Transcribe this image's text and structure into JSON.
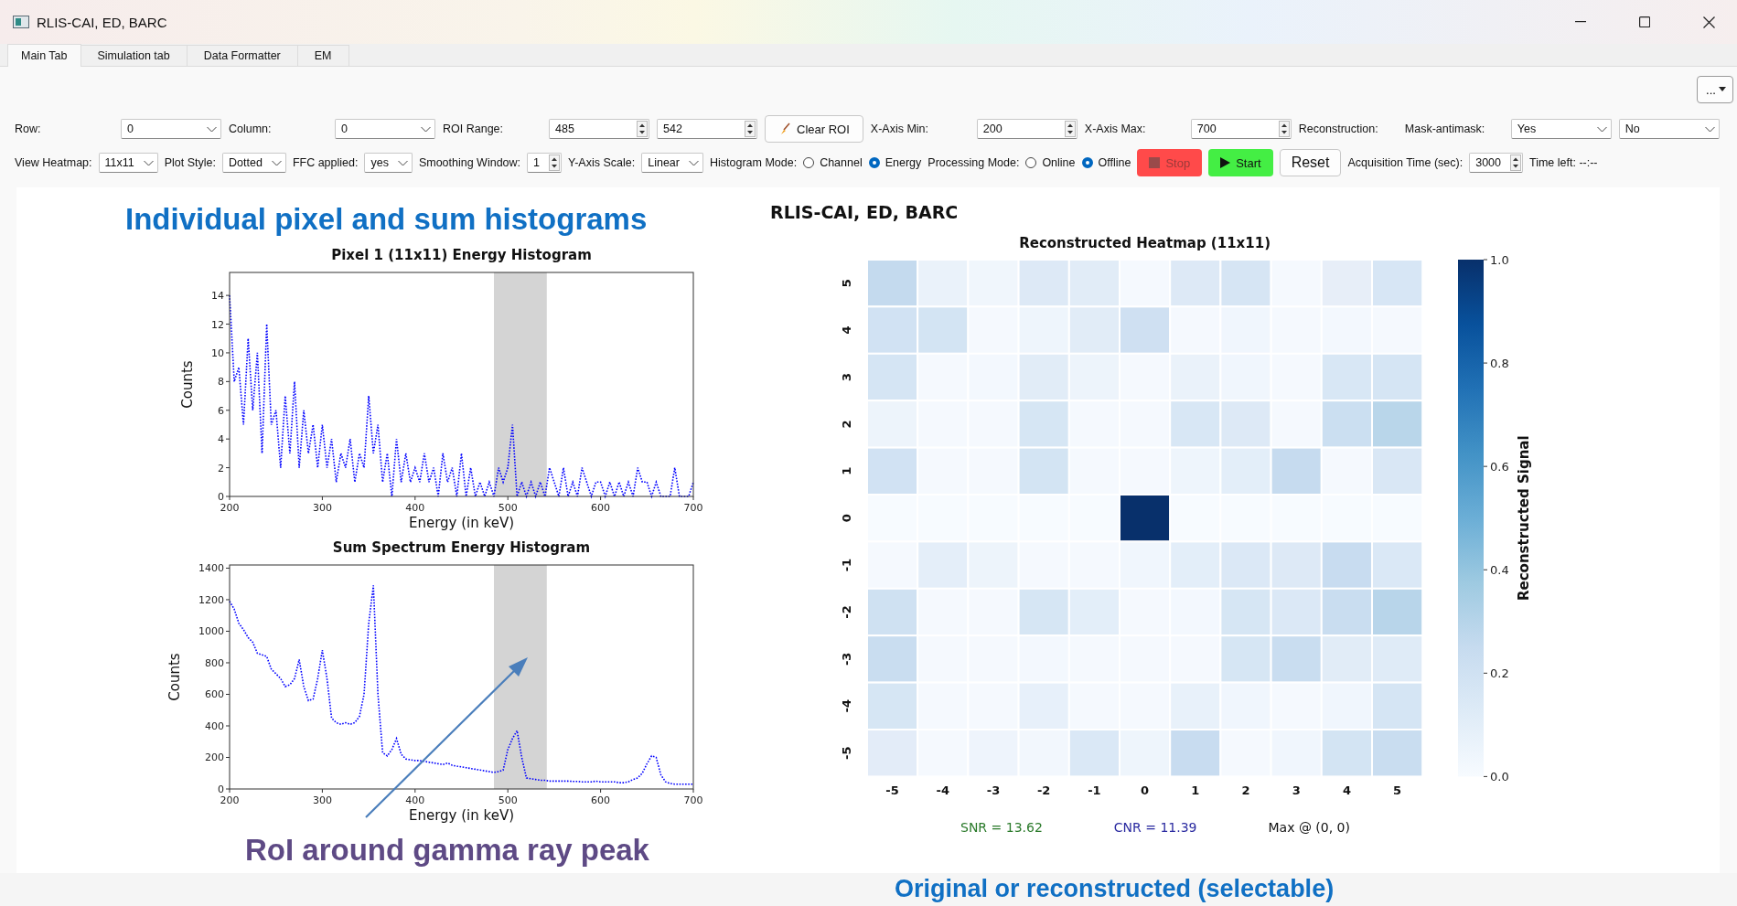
{
  "window": {
    "title": "RLIS-CAI, ED, BARC"
  },
  "tabs": [
    {
      "label": "Main Tab",
      "selected": true
    },
    {
      "label": "Simulation tab",
      "selected": false
    },
    {
      "label": "Data Formatter",
      "selected": false
    },
    {
      "label": "EM",
      "selected": false
    }
  ],
  "more_button": {
    "text": "..."
  },
  "toolbar_rows": [
    [
      {
        "kind": "label",
        "text": "Row:"
      },
      {
        "kind": "combo",
        "value": "0"
      },
      {
        "kind": "label",
        "text": "Column:"
      },
      {
        "kind": "combo",
        "value": "0"
      },
      {
        "kind": "label",
        "text": "ROI Range:"
      },
      {
        "kind": "spin",
        "value": "485"
      },
      {
        "kind": "spin",
        "value": "542"
      },
      {
        "kind": "brushbutton",
        "text": "Clear ROI",
        "disabled": false
      },
      {
        "kind": "label",
        "text": "X-Axis Min:"
      },
      {
        "kind": "spin",
        "value": "200"
      },
      {
        "kind": "label",
        "text": "X-Axis Max:"
      },
      {
        "kind": "spin",
        "value": "700"
      },
      {
        "kind": "label",
        "text": "Reconstruction:"
      },
      {
        "kind": "label",
        "text": "Mask-antimask:"
      },
      {
        "kind": "combo",
        "value": "Yes"
      },
      {
        "kind": "combo",
        "value": "No"
      }
    ],
    [
      {
        "kind": "label",
        "text": "View Heatmap:"
      },
      {
        "kind": "combo",
        "value": "11x11"
      },
      {
        "kind": "label",
        "text": "Plot Style:"
      },
      {
        "kind": "combo",
        "value": "Dotted"
      },
      {
        "kind": "label",
        "text": "FFC applied:"
      },
      {
        "kind": "combo",
        "value": "yes"
      },
      {
        "kind": "label",
        "text": "Smoothing Window:"
      },
      {
        "kind": "spin",
        "value": "1"
      },
      {
        "kind": "label",
        "text": "Y-Axis Scale:"
      },
      {
        "kind": "combo",
        "value": "Linear"
      },
      {
        "kind": "label",
        "text": "Histogram Mode:"
      },
      {
        "kind": "radio",
        "text": "Channel",
        "selected": false
      },
      {
        "kind": "radio",
        "text": "Energy",
        "selected": true
      },
      {
        "kind": "label",
        "text": "Processing Mode:"
      },
      {
        "kind": "radio",
        "text": "Online",
        "selected": false
      },
      {
        "kind": "radio",
        "text": "Offline",
        "selected": true
      },
      {
        "kind": "stopbutton",
        "text": "Stop",
        "color": "#ff4a4a",
        "disabled": true
      },
      {
        "kind": "startbutton",
        "text": "Start",
        "color": "#44ee44",
        "disabled": false
      },
      {
        "kind": "button",
        "text": "Reset",
        "disabled": false
      },
      {
        "kind": "label",
        "text": "Acquisition Time (sec):"
      },
      {
        "kind": "spin",
        "value": "3000"
      },
      {
        "kind": "label",
        "text": "Time left: --:--"
      }
    ]
  ],
  "left_panel": {
    "heading": "Individual pixel and sum histograms",
    "charts": [
      {
        "chart_data": {
          "type": "line",
          "title": "Pixel 1 (11x11) Energy Histogram",
          "xlabel": "Energy (in keV)",
          "ylabel": "Counts",
          "x": [
            200,
            205,
            210,
            215,
            220,
            225,
            230,
            235,
            240,
            245,
            250,
            255,
            260,
            265,
            270,
            275,
            280,
            285,
            290,
            295,
            300,
            305,
            310,
            315,
            320,
            325,
            330,
            335,
            340,
            345,
            350,
            355,
            360,
            365,
            370,
            375,
            380,
            385,
            390,
            395,
            400,
            405,
            410,
            415,
            420,
            425,
            430,
            435,
            440,
            445,
            450,
            455,
            460,
            465,
            470,
            475,
            480,
            485,
            490,
            495,
            500,
            505,
            510,
            515,
            520,
            525,
            530,
            535,
            540,
            545,
            550,
            555,
            560,
            565,
            570,
            575,
            580,
            585,
            590,
            595,
            600,
            605,
            610,
            615,
            620,
            625,
            630,
            635,
            640,
            645,
            650,
            655,
            660,
            665,
            670,
            675,
            680,
            685,
            690,
            695,
            700
          ],
          "series": [
            {
              "color": "#0000ff",
              "line_style": "dotted",
              "values": [
                14,
                8,
                9,
                5,
                11,
                6,
                10,
                3,
                12,
                5,
                6,
                2,
                7,
                3,
                8,
                2,
                6,
                3,
                5,
                2,
                5,
                2,
                4,
                1,
                3,
                2,
                4,
                1,
                3,
                2,
                7,
                3,
                5,
                1,
                3,
                0,
                4,
                1,
                3,
                1,
                2,
                1,
                3,
                1,
                2,
                0,
                3,
                1,
                2,
                0,
                3,
                0,
                2,
                0,
                1,
                0,
                1,
                0,
                2,
                1,
                2,
                5,
                0,
                1,
                0,
                1,
                0,
                1,
                0,
                2,
                1,
                0,
                2,
                0,
                1,
                0,
                2,
                1,
                0,
                1,
                1,
                0,
                1,
                0,
                1,
                0,
                1,
                0,
                2,
                1,
                1,
                0,
                1,
                0,
                0,
                0,
                2,
                0,
                0,
                0,
                1
              ]
            }
          ],
          "xlim": [
            200,
            700
          ],
          "ylim": [
            0,
            15.6
          ],
          "xticks": [
            200,
            300,
            400,
            500,
            600,
            700
          ],
          "yticks": [
            0,
            2,
            4,
            6,
            8,
            10,
            12,
            14
          ],
          "bands": [
            {
              "axis": "x",
              "from": 485,
              "to": 542,
              "color": "#d4d4d4"
            }
          ]
        }
      },
      {
        "chart_data": {
          "type": "line",
          "title": "Sum Spectrum Energy Histogram",
          "xlabel": "Energy (in keV)",
          "ylabel": "Counts",
          "x": [
            200,
            205,
            210,
            215,
            220,
            225,
            230,
            235,
            240,
            245,
            250,
            255,
            260,
            265,
            270,
            275,
            280,
            285,
            290,
            295,
            300,
            305,
            310,
            315,
            320,
            325,
            330,
            335,
            340,
            345,
            350,
            355,
            360,
            365,
            370,
            375,
            380,
            385,
            390,
            395,
            400,
            405,
            410,
            415,
            420,
            425,
            430,
            435,
            440,
            445,
            450,
            455,
            460,
            465,
            470,
            475,
            480,
            485,
            490,
            495,
            500,
            505,
            510,
            515,
            520,
            525,
            530,
            535,
            540,
            545,
            550,
            555,
            560,
            565,
            570,
            575,
            580,
            585,
            590,
            595,
            600,
            605,
            610,
            615,
            620,
            625,
            630,
            635,
            640,
            645,
            650,
            655,
            660,
            665,
            670,
            675,
            680,
            685,
            690,
            695,
            700
          ],
          "series": [
            {
              "color": "#0000ff",
              "line_style": "dotted",
              "values": [
                1190,
                1140,
                1050,
                1010,
                960,
                930,
                860,
                850,
                840,
                760,
                730,
                700,
                650,
                660,
                700,
                820,
                650,
                560,
                570,
                700,
                880,
                700,
                450,
                420,
                410,
                420,
                410,
                420,
                460,
                600,
                1050,
                1290,
                600,
                230,
                210,
                250,
                320,
                220,
                190,
                185,
                180,
                180,
                175,
                170,
                165,
                160,
                155,
                165,
                150,
                145,
                140,
                135,
                130,
                125,
                120,
                115,
                110,
                105,
                110,
                120,
                250,
                320,
                370,
                200,
                70,
                65,
                60,
                55,
                55,
                50,
                50,
                50,
                50,
                50,
                48,
                48,
                45,
                45,
                45,
                50,
                45,
                45,
                45,
                45,
                40,
                40,
                45,
                60,
                70,
                100,
                160,
                210,
                200,
                90,
                45,
                35,
                30,
                30,
                30,
                30,
                30
              ]
            }
          ],
          "xlim": [
            200,
            700
          ],
          "ylim": [
            0,
            1420
          ],
          "xticks": [
            200,
            300,
            400,
            500,
            600,
            700
          ],
          "yticks": [
            0,
            200,
            400,
            600,
            800,
            1000,
            1200,
            1400
          ],
          "bands": [
            {
              "axis": "x",
              "from": 485,
              "to": 542,
              "color": "#d4d4d4"
            }
          ]
        }
      }
    ],
    "note": "RoI around gamma ray peak"
  },
  "right_panel": {
    "heading": "RLIS-CAI, ED, BARC",
    "heatmap": {
      "title": "Reconstructed Heatmap (11x11)",
      "column_labels": [
        "-5",
        "-4",
        "-3",
        "-2",
        "-1",
        "0",
        "1",
        "2",
        "3",
        "4",
        "5"
      ],
      "rows": [
        {
          "label": "5",
          "cells": [
            {
              "color": "#c4daee"
            },
            {
              "color": "#eaf2fa"
            },
            {
              "color": "#f0f6fc"
            },
            {
              "color": "#dde9f6"
            },
            {
              "color": "#e1ecf7"
            },
            {
              "color": "#f5f9fe"
            },
            {
              "color": "#dde9f6"
            },
            {
              "color": "#d6e5f4"
            },
            {
              "color": "#f5f9fe"
            },
            {
              "color": "#e7eef8"
            },
            {
              "color": "#d7e6f5"
            }
          ]
        },
        {
          "label": "4",
          "cells": [
            {
              "color": "#d1e2f3"
            },
            {
              "color": "#d3e4f3"
            },
            {
              "color": "#f5f9fe"
            },
            {
              "color": "#eef5fc"
            },
            {
              "color": "#e1ecf7"
            },
            {
              "color": "#cfe0f2"
            },
            {
              "color": "#f5f9fe"
            },
            {
              "color": "#f0f6fd"
            },
            {
              "color": "#f5f9fe"
            },
            {
              "color": "#f3f8fe"
            },
            {
              "color": "#f5f9fe"
            }
          ]
        },
        {
          "label": "3",
          "cells": [
            {
              "color": "#d5e5f4"
            },
            {
              "color": "#f5f9fe"
            },
            {
              "color": "#f3f8fe"
            },
            {
              "color": "#e1ecf7"
            },
            {
              "color": "#edf4fb"
            },
            {
              "color": "#f5f9fe"
            },
            {
              "color": "#eaf2fa"
            },
            {
              "color": "#f0f6fd"
            },
            {
              "color": "#f5f9fe"
            },
            {
              "color": "#d8e7f5"
            },
            {
              "color": "#d5e5f4"
            }
          ]
        },
        {
          "label": "2",
          "cells": [
            {
              "color": "#edf4fb"
            },
            {
              "color": "#f5f9fe"
            },
            {
              "color": "#f5f9fe"
            },
            {
              "color": "#d6e6f4"
            },
            {
              "color": "#f5f9fe"
            },
            {
              "color": "#f5f9fe"
            },
            {
              "color": "#d8e7f5"
            },
            {
              "color": "#dde9f6"
            },
            {
              "color": "#f5f9fe"
            },
            {
              "color": "#cbdff1"
            },
            {
              "color": "#b9d6ea"
            }
          ]
        },
        {
          "label": "1",
          "cells": [
            {
              "color": "#d1e2f3"
            },
            {
              "color": "#f5f9fe"
            },
            {
              "color": "#f5f9fe"
            },
            {
              "color": "#d3e4f3"
            },
            {
              "color": "#f5f9fe"
            },
            {
              "color": "#f5f9fe"
            },
            {
              "color": "#eef5fc"
            },
            {
              "color": "#e3eef9"
            },
            {
              "color": "#c6dbef"
            },
            {
              "color": "#f5f9fe"
            },
            {
              "color": "#d9e7f5"
            }
          ]
        },
        {
          "label": "0",
          "cells": [
            {
              "color": "#f7fbff"
            },
            {
              "color": "#f7fbff"
            },
            {
              "color": "#f7fbff"
            },
            {
              "color": "#f7fbff"
            },
            {
              "color": "#f7fbff"
            },
            {
              "color": "#08306b"
            },
            {
              "color": "#f7fbff"
            },
            {
              "color": "#f7fbff"
            },
            {
              "color": "#f7fbff"
            },
            {
              "color": "#f7fbff"
            },
            {
              "color": "#f7fbff"
            }
          ]
        },
        {
          "label": "-1",
          "cells": [
            {
              "color": "#f5f9fe"
            },
            {
              "color": "#e4eef9"
            },
            {
              "color": "#edf4fb"
            },
            {
              "color": "#f5f9fe"
            },
            {
              "color": "#f5f9fe"
            },
            {
              "color": "#f0f6fd"
            },
            {
              "color": "#e3eef9"
            },
            {
              "color": "#dbe8f6"
            },
            {
              "color": "#dde9f6"
            },
            {
              "color": "#c8dcf0"
            },
            {
              "color": "#dae8f6"
            }
          ]
        },
        {
          "label": "-2",
          "cells": [
            {
              "color": "#cfe1f2"
            },
            {
              "color": "#f5f9fe"
            },
            {
              "color": "#f5f9fe"
            },
            {
              "color": "#d6e6f4"
            },
            {
              "color": "#e3eef9"
            },
            {
              "color": "#f5f9fe"
            },
            {
              "color": "#f3f8fe"
            },
            {
              "color": "#d6e6f4"
            },
            {
              "color": "#dbe8f6"
            },
            {
              "color": "#c9ddf0"
            },
            {
              "color": "#b8d5ea"
            }
          ]
        },
        {
          "label": "-3",
          "cells": [
            {
              "color": "#c9ddf0"
            },
            {
              "color": "#f5f9fe"
            },
            {
              "color": "#f5f9fe"
            },
            {
              "color": "#f3f8fe"
            },
            {
              "color": "#f5f9fe"
            },
            {
              "color": "#f5f9fe"
            },
            {
              "color": "#f5f9fe"
            },
            {
              "color": "#d6e6f4"
            },
            {
              "color": "#c9ddf0"
            },
            {
              "color": "#e1ecf7"
            },
            {
              "color": "#dfebf7"
            }
          ]
        },
        {
          "label": "-4",
          "cells": [
            {
              "color": "#d6e6f4"
            },
            {
              "color": "#f5f9fe"
            },
            {
              "color": "#f5f9fe"
            },
            {
              "color": "#e7f0fa"
            },
            {
              "color": "#f5f9fe"
            },
            {
              "color": "#f5f9fe"
            },
            {
              "color": "#e8f1fa"
            },
            {
              "color": "#f0f6fd"
            },
            {
              "color": "#f5f9fe"
            },
            {
              "color": "#f0f6fd"
            },
            {
              "color": "#d5e5f4"
            }
          ]
        },
        {
          "label": "-5",
          "cells": [
            {
              "color": "#e3ecf8"
            },
            {
              "color": "#f5f9fe"
            },
            {
              "color": "#eef4fc"
            },
            {
              "color": "#f2f7fd"
            },
            {
              "color": "#dae8f6"
            },
            {
              "color": "#eef5fc"
            },
            {
              "color": "#c8dcf0"
            },
            {
              "color": "#f5f9fe"
            },
            {
              "color": "#f0f6fd"
            },
            {
              "color": "#d3e4f3"
            },
            {
              "color": "#c9ddf0"
            }
          ]
        }
      ],
      "colorbar": {
        "label": "Reconstructed Signal",
        "ticks": [
          "1.0",
          "0.8",
          "0.6",
          "0.4",
          "0.2",
          "0.0"
        ]
      }
    },
    "stats": [
      {
        "text": "SNR = 13.62",
        "color": "#2a7a2a"
      },
      {
        "text": "CNR = 11.39",
        "color": "#2a2aa0"
      },
      {
        "text": "Max @ (0, 0)",
        "color": "#111111"
      }
    ]
  },
  "footer_note": "Original or reconstructed (selectable)"
}
